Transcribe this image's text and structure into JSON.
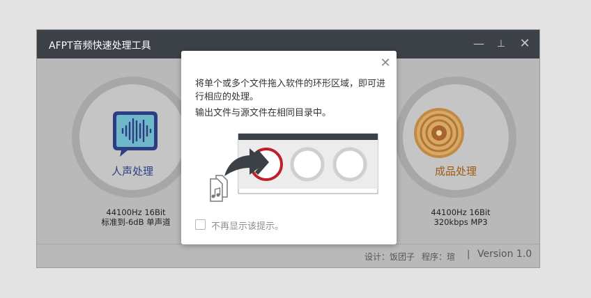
{
  "window": {
    "title": "AFPT音频快速处理工具",
    "min_glyph": "—",
    "pin_glyph": "⊥",
    "close_glyph": "✕"
  },
  "left_zone": {
    "label": "人声处理",
    "info_line1": "44100Hz 16Bit",
    "info_line2": "标准到-6dB 单声道",
    "icon": "voice-waveform-bubble-icon"
  },
  "right_zone": {
    "label": "成品处理",
    "info_line1": "44100Hz 16Bit",
    "info_line2": "320kbps MP3",
    "icon": "vinyl-disc-icon"
  },
  "footer": {
    "design_credit": "设计：饭团子",
    "program_credit": "程序：瑄",
    "divider": "|",
    "version": "Version 1.0"
  },
  "dialog": {
    "close_glyph": "✕",
    "line1": "将单个或多个文件拖入软件的环形区域，即可进行相应的处理。",
    "line2": "输出文件与源文件在相同目录中。",
    "checkbox_label": "不再显示该提示。",
    "checkbox_checked": false,
    "illustration": "drag-files-to-ring-illustration"
  },
  "colors": {
    "titlebar": "#3c4148",
    "voice_accent": "#2d3d84",
    "voice_fill": "#6fb8c9",
    "product_accent": "#a05a10",
    "product_gold": "#c18a43",
    "ring_red": "#c01f28"
  }
}
